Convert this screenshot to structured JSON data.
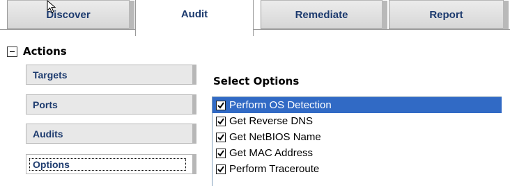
{
  "tabs": [
    {
      "label": "Discover",
      "active": false
    },
    {
      "label": "Audit",
      "active": true
    },
    {
      "label": "Remediate",
      "active": false
    },
    {
      "label": "Report",
      "active": false
    }
  ],
  "actions": {
    "title": "Actions",
    "toggle_icon": "collapse-minus-icon",
    "buttons": [
      {
        "label": "Targets",
        "selected": false
      },
      {
        "label": "Ports",
        "selected": false
      },
      {
        "label": "Audits",
        "selected": false
      },
      {
        "label": "Options",
        "selected": true
      }
    ]
  },
  "options_panel": {
    "title": "Select Options",
    "items": [
      {
        "label": "Perform OS Detection",
        "checked": true,
        "highlighted": true
      },
      {
        "label": "Get Reverse DNS",
        "checked": true,
        "highlighted": false
      },
      {
        "label": "Get NetBIOS Name",
        "checked": true,
        "highlighted": false
      },
      {
        "label": "Get MAC Address",
        "checked": true,
        "highlighted": false
      },
      {
        "label": "Perform Traceroute",
        "checked": true,
        "highlighted": false
      }
    ]
  },
  "colors": {
    "tab_text": "#1c3a6e",
    "selection": "#316ac5"
  }
}
